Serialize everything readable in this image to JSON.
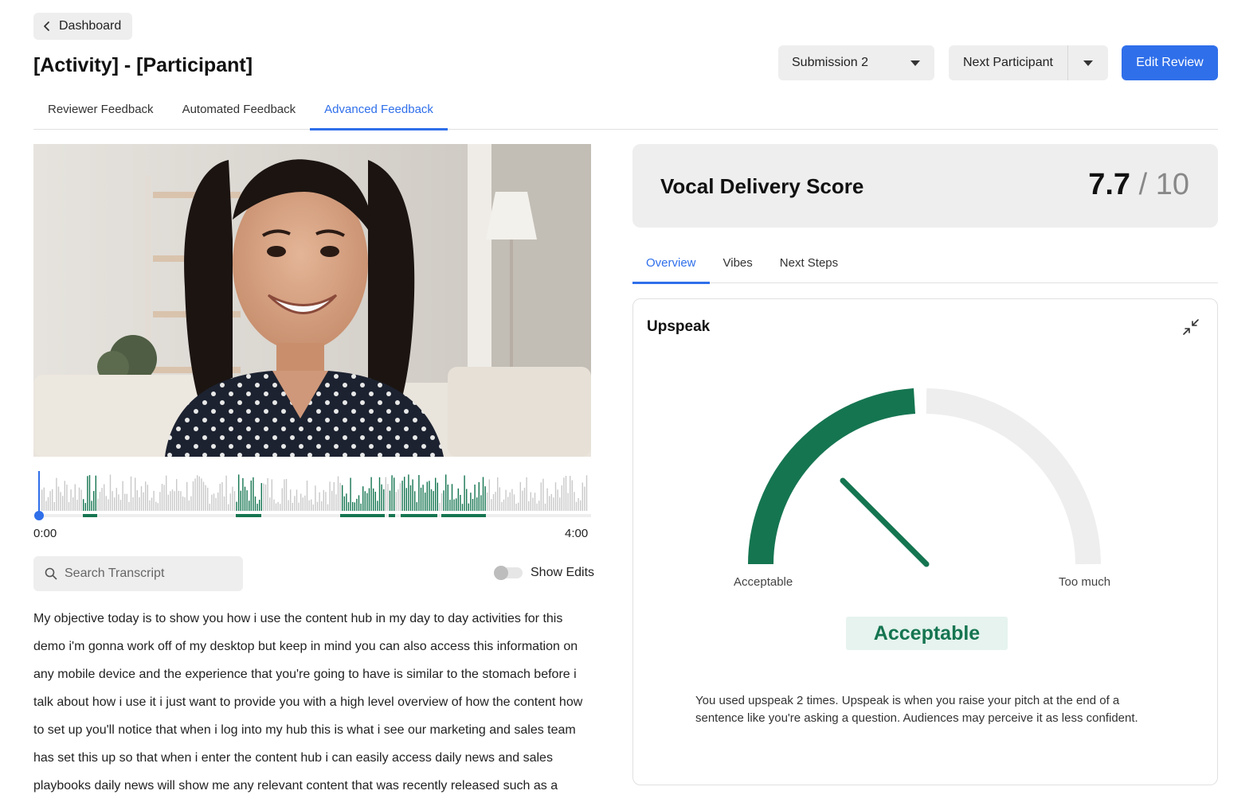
{
  "header": {
    "back_label": "Dashboard",
    "title": "[Activity] - [Participant]",
    "submission_select": "Submission 2",
    "next_participant_label": "Next Participant",
    "edit_review_label": "Edit Review"
  },
  "main_tabs": [
    {
      "label": "Reviewer Feedback",
      "active": false
    },
    {
      "label": "Automated Feedback",
      "active": false
    },
    {
      "label": "Advanced Feedback",
      "active": true
    }
  ],
  "player": {
    "time_current": "0:00",
    "time_total": "4:00",
    "progress": 0
  },
  "transcript": {
    "search_placeholder": "Search Transcript",
    "show_edits_label": "Show Edits",
    "show_edits_on": false,
    "text": "My objective today is to show you how i use the content hub in my day to day activities for this demo i'm gonna work off of my desktop but keep in mind you can also access this information on any mobile device and the experience that you're going to have is similar to the stomach before i talk about how i use it i just want to provide you with a high level overview of how the content how to set up you'll notice that when i log into my hub this is what i see our marketing and sales team has set this up so that when i enter the content hub i can easily access daily news and sales playbooks daily news will show me any relevant content that was recently released such as a"
  },
  "score": {
    "label": "Vocal Delivery Score",
    "value": "7.7",
    "max": "/ 10"
  },
  "sub_tabs": [
    {
      "label": "Overview",
      "active": true
    },
    {
      "label": "Vibes",
      "active": false
    },
    {
      "label": "Next Steps",
      "active": false
    }
  ],
  "metric": {
    "title": "Upspeak",
    "gauge_left_label": "Acceptable",
    "gauge_right_label": "Too much",
    "gauge_level": 0.5,
    "status": "Acceptable",
    "description": "You used upspeak 2 times. Upspeak is when you raise your pitch at the end of a sentence like you're asking a question. Audiences may perceive it as less confident."
  },
  "colors": {
    "accent_blue": "#2f6fea",
    "highlight_green": "#157551",
    "waveform_gray": "#c9c9c9"
  }
}
